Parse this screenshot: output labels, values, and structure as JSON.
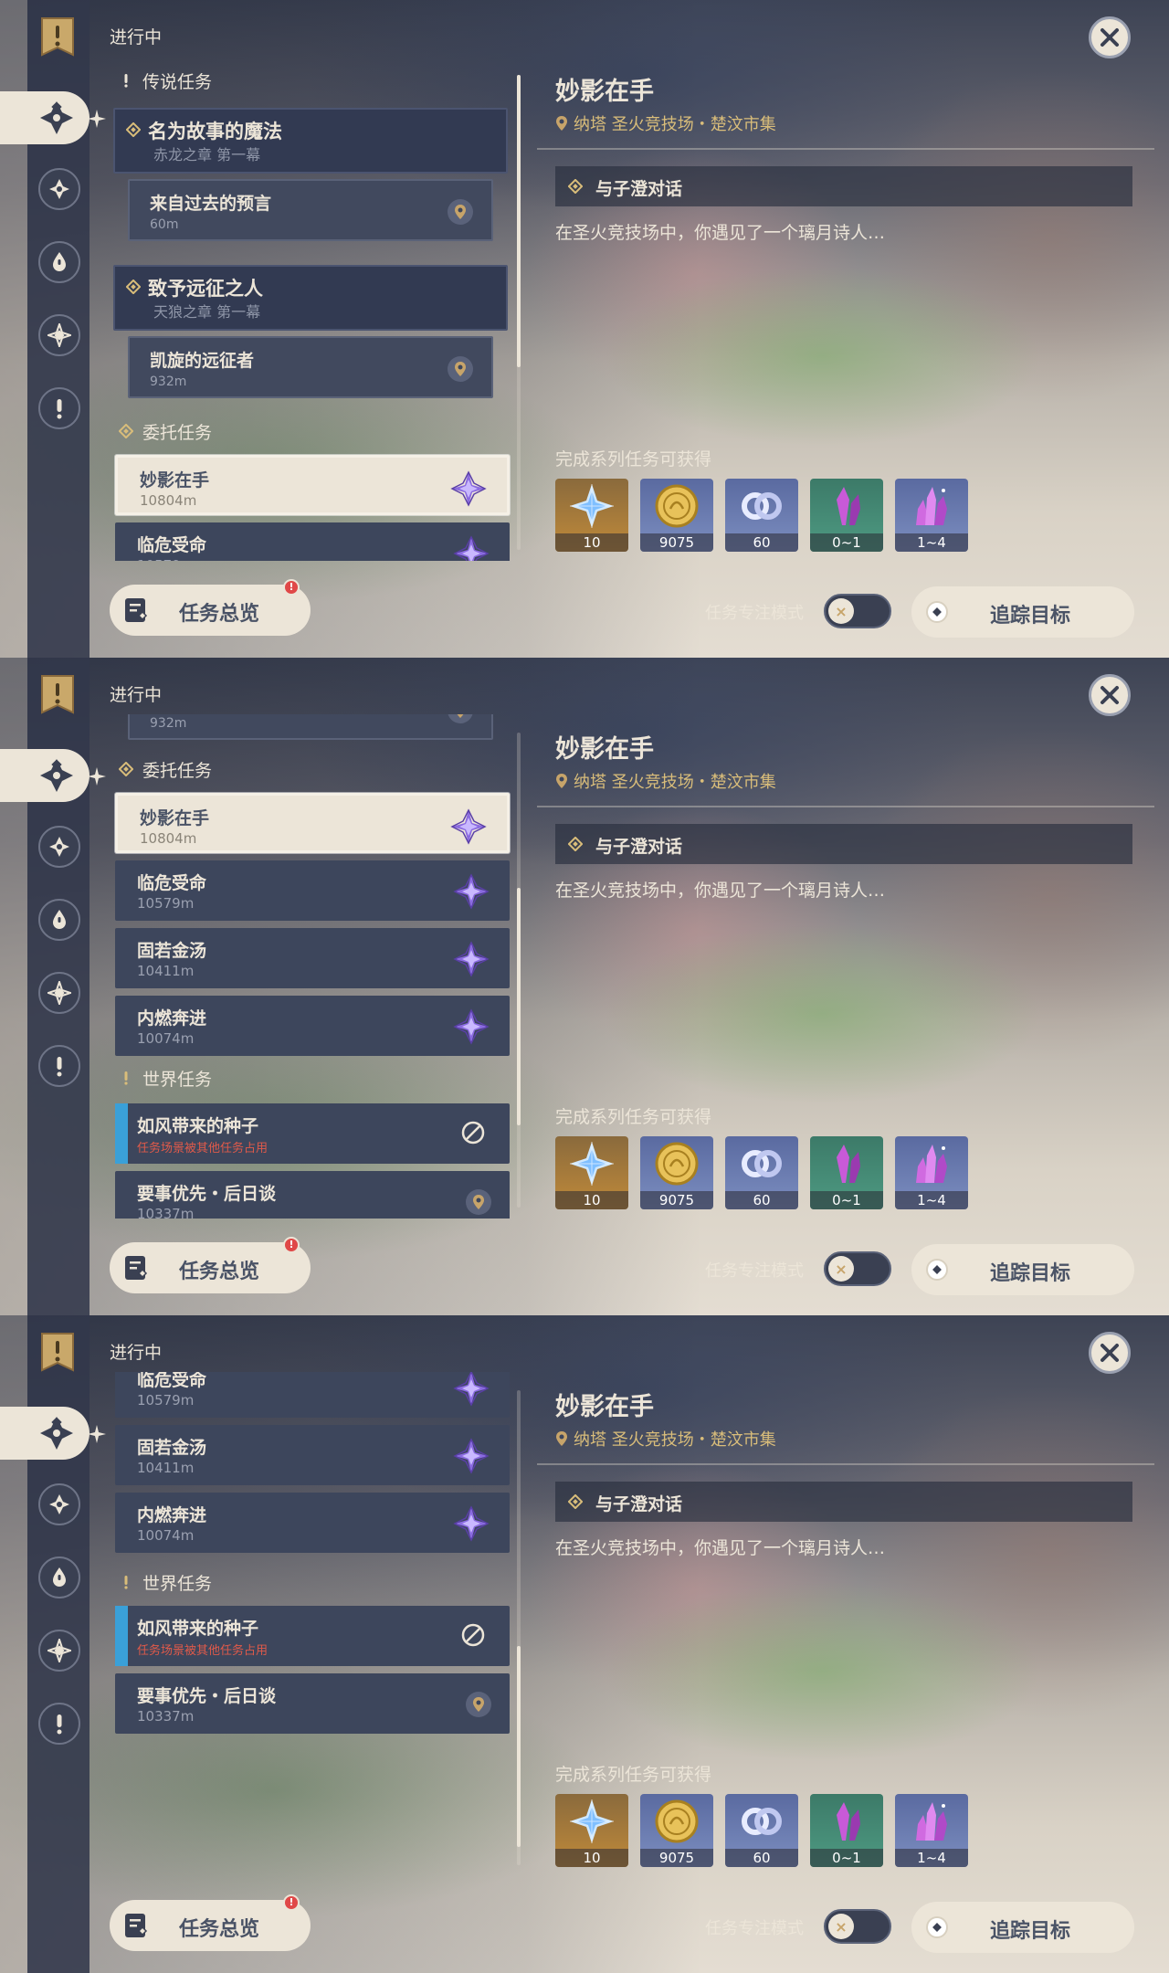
{
  "status_label": "进行中",
  "sections": {
    "archon": "传说任务",
    "commission": "委托任务",
    "world": "世界任务"
  },
  "quests": {
    "archon1": {
      "title": "名为故事的魔法",
      "subtitle": "赤龙之章 第一幕"
    },
    "archon1_step": {
      "title": "来自过去的预言",
      "distance": "60m"
    },
    "archon2": {
      "title": "致予远征之人",
      "subtitle": "天狼之章 第一幕"
    },
    "archon2_step": {
      "title": "凯旋的远征者",
      "distance": "932m"
    },
    "c1": {
      "title": "妙影在手",
      "distance": "10804m"
    },
    "c2": {
      "title": "临危受命",
      "distance": "10579m"
    },
    "c3": {
      "title": "固若金汤",
      "distance": "10411m"
    },
    "c4": {
      "title": "内燃奔进",
      "distance": "10074m"
    },
    "w1": {
      "title": "如风带来的种子",
      "warning": "任务场景被其他任务占用"
    },
    "w2": {
      "title": "要事优先・后日谈",
      "distance": "10337m"
    }
  },
  "detail": {
    "title": "妙影在手",
    "location": "纳塔 圣火竞技场・楚汶市集",
    "objective": "与子澄对话",
    "description": "在圣火竞技场中，你遇见了一个璃月诗人…",
    "rewards_label": "完成系列任务可获得",
    "rewards": [
      {
        "icon": "primogem-icon",
        "count": "10"
      },
      {
        "icon": "mora-icon",
        "count": "9075"
      },
      {
        "icon": "adventure-exp-icon",
        "count": "60"
      },
      {
        "icon": "crystal-chunk-icon",
        "count": "0~1"
      },
      {
        "icon": "crystal-cluster-icon",
        "count": "1~4"
      }
    ]
  },
  "bottom": {
    "overview_label": "任务总览",
    "overview_badge": "!",
    "focus_mode_label": "任务专注模式",
    "track_label": "追踪目标"
  },
  "colors": {
    "cream": "#ece5d8",
    "slate": "#3d465c",
    "gold_text": "#d9bd7a",
    "warning": "#e05a4a",
    "commission_purple": "#7a5cc8"
  }
}
